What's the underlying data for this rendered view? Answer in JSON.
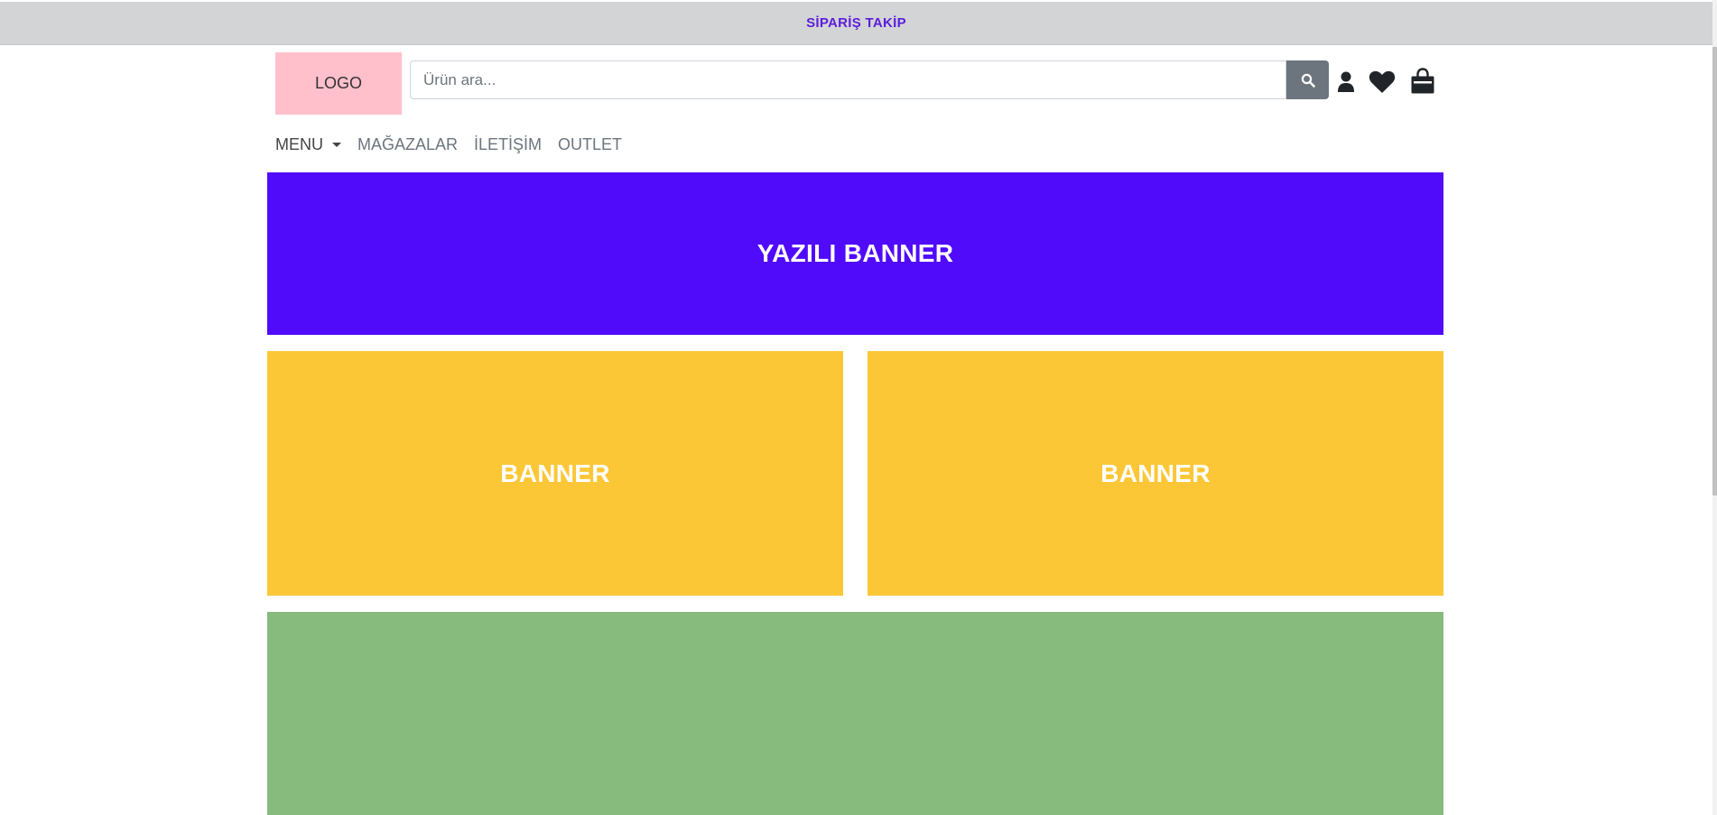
{
  "topbar": {
    "link": "SİPARİŞ TAKİP",
    "link_color": "#5b1ddc",
    "background": "#d3d4d5"
  },
  "header": {
    "logo": "LOGO",
    "logo_bg": "#ffc0cb",
    "search": {
      "placeholder": "Ürün ara...",
      "value": "",
      "button_icon": "search-icon"
    },
    "icons": [
      "user-icon",
      "heart-icon",
      "shopping-bag-icon"
    ]
  },
  "nav": {
    "menu": "MENU",
    "items": [
      "MAĞAZALAR",
      "İLETİŞİM",
      "OUTLET"
    ]
  },
  "banners": {
    "top": {
      "label": "YAZILI BANNER",
      "color": "#500bfa"
    },
    "left": {
      "label": "BANNER",
      "color": "#fbc737"
    },
    "right": {
      "label": "BANNER",
      "color": "#fbc737"
    },
    "bottom": {
      "label": "",
      "color": "#86bb7d"
    }
  }
}
